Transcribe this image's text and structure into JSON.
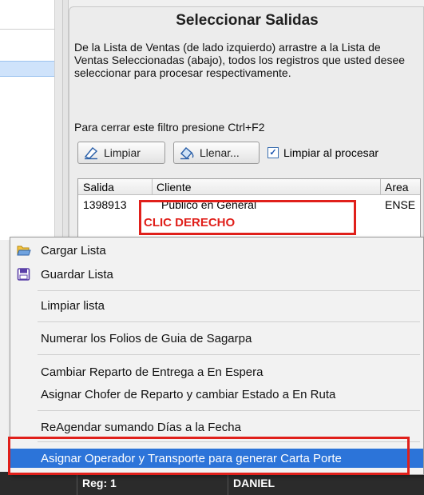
{
  "panel": {
    "title": "Seleccionar Salidas",
    "description": "De la Lista de Ventas (de lado izquierdo) arrastre a la Lista de Ventas Seleccionadas (abajo), todos los registros que usted desee seleccionar para procesar respectivamente.",
    "hint": "Para cerrar este filtro presione Ctrl+F2",
    "buttons": {
      "clear_label": "Limpiar",
      "fill_label": "Llenar..."
    },
    "checkbox": {
      "label": "Limpiar al procesar",
      "checked": true
    },
    "grid": {
      "columns": [
        "Salida",
        "Cliente",
        "Area"
      ],
      "rows": [
        [
          "1398913",
          "Publico en General",
          "ENSE"
        ]
      ]
    }
  },
  "annotation": {
    "right_click_label": "CLIC DERECHO",
    "color": "#e0201b"
  },
  "context_menu": {
    "items": [
      {
        "label": "Cargar Lista",
        "icon": "folder-open-icon"
      },
      {
        "label": "Guardar Lista",
        "icon": "save-icon"
      },
      {
        "label": "Limpiar lista"
      },
      {
        "label": "Numerar los Folios de Guia de Sagarpa"
      },
      {
        "label": "Cambiar Reparto de Entrega a En Espera"
      },
      {
        "label": "Asignar Chofer de Reparto y cambiar Estado a En Ruta"
      },
      {
        "label": "ReAgendar sumando Días a la Fecha"
      },
      {
        "label": "Asignar Operador y Transporte para generar Carta Porte",
        "highlighted": true
      }
    ],
    "highlight_color": "#2c74d9"
  },
  "status_bar": {
    "reg": "Reg: 1",
    "name": "DANIEL"
  }
}
